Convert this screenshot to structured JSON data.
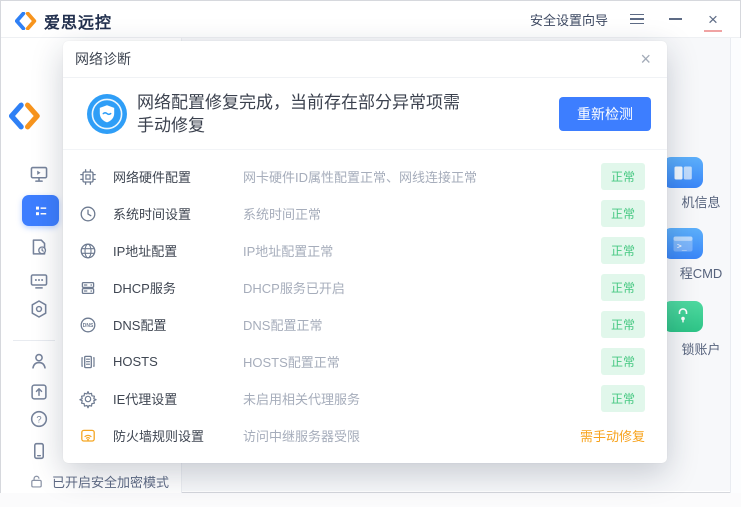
{
  "app": {
    "logo_text": "爱思远控",
    "titlebar": {
      "wizard_label": "安全设置向导",
      "close_glyph": "×"
    },
    "statusbar": {
      "text": "已开启安全加密模式"
    },
    "right_panel": {
      "items": [
        {
          "icon": "host-info-icon",
          "label": "机信息"
        },
        {
          "icon": "terminal-icon",
          "label": "程CMD"
        },
        {
          "icon": "unlock-account-icon",
          "label": "锁账户"
        }
      ]
    }
  },
  "dialog": {
    "title": "网络诊断",
    "close_glyph": "×",
    "header": {
      "icon": "shield-check-icon",
      "message": "网络配置修复完成，当前存在部分异常项需手动修复",
      "button_label": "重新检测"
    },
    "rows": [
      {
        "icon": "chip-icon",
        "label": "网络硬件配置",
        "desc": "网卡硬件ID属性配置正常、网线连接正常",
        "status": "正常",
        "status_type": "ok"
      },
      {
        "icon": "clock-icon",
        "label": "系统时间设置",
        "desc": "系统时间正常",
        "status": "正常",
        "status_type": "ok"
      },
      {
        "icon": "globe-icon",
        "label": "IP地址配置",
        "desc": "IP地址配置正常",
        "status": "正常",
        "status_type": "ok"
      },
      {
        "icon": "server-icon",
        "label": "DHCP服务",
        "desc": "DHCP服务已开启",
        "status": "正常",
        "status_type": "ok"
      },
      {
        "icon": "dns-globe-icon",
        "label": "DNS配置",
        "desc": "DNS配置正常",
        "status": "正常",
        "status_type": "ok"
      },
      {
        "icon": "hosts-icon",
        "label": "HOSTS",
        "desc": "HOSTS配置正常",
        "status": "正常",
        "status_type": "ok"
      },
      {
        "icon": "gear-icon",
        "label": "IE代理设置",
        "desc": "未启用相关代理服务",
        "status": "正常",
        "status_type": "ok"
      },
      {
        "icon": "firewall-icon",
        "label": "防火墙规则设置",
        "desc": "访问中继服务器受限",
        "status": "需手动修复",
        "status_type": "warn"
      }
    ]
  },
  "colors": {
    "accent_blue": "#3d7eff",
    "brand_blue": "#2f80f5",
    "brand_orange": "#f7941d",
    "status_ok_bg": "#e1f7eb",
    "status_ok_text": "#46c882",
    "status_warn_text": "#f7a21b",
    "close_underline": "#f0a3a3"
  }
}
